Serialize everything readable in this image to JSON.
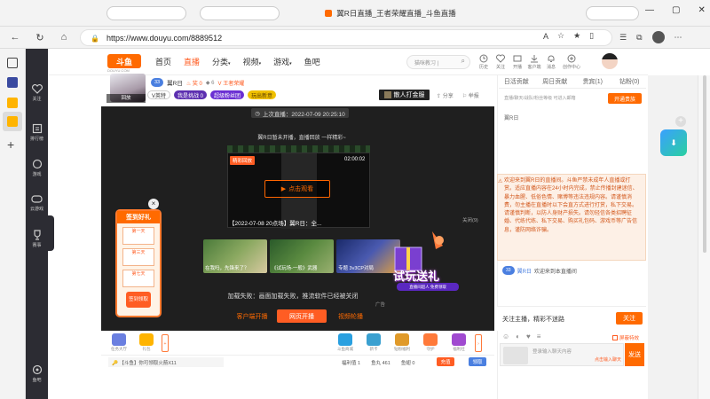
{
  "browser": {
    "window_title": "翼R日直播_王者荣耀直播_斗鱼直播",
    "url": "https://www.douyu.com/8889512",
    "reading_mode_label": "A"
  },
  "browser_sidebar": {
    "icons": [
      "tabs-icon",
      "extensions-icon",
      "douyu-tab-icon",
      "douyu-active-tab-icon",
      "add-icon"
    ]
  },
  "site_nav": {
    "items": [
      {
        "label": "关注",
        "icon": "heart-icon"
      },
      {
        "label": "排行榜",
        "icon": "rank-icon"
      },
      {
        "label": "游戏",
        "icon": "game-icon"
      },
      {
        "label": "云游戏",
        "icon": "cloud-game-icon"
      },
      {
        "label": "赛事",
        "icon": "trophy-icon"
      },
      {
        "label": "鱼吧",
        "icon": "fish-bar-icon"
      }
    ]
  },
  "header": {
    "logo": "斗鱼",
    "logo_sub": "DOUYU.COM",
    "nav": [
      {
        "label": "首页",
        "active": false
      },
      {
        "label": "直播",
        "active": true
      },
      {
        "label": "分类",
        "dropdown": true
      },
      {
        "label": "视频",
        "dropdown": true
      },
      {
        "label": "游戏",
        "dropdown": true
      },
      {
        "label": "鱼吧",
        "dropdown": false
      }
    ],
    "search_placeholder": "猫咪教习 |",
    "icons": [
      {
        "label": "历史",
        "icon": "history-icon"
      },
      {
        "label": "关注",
        "icon": "heart-icon"
      },
      {
        "label": "开播",
        "icon": "broadcast-icon"
      },
      {
        "label": "客户端",
        "icon": "download-icon"
      },
      {
        "label": "消息",
        "icon": "bell-icon"
      },
      {
        "label": "创作中心",
        "icon": "create-icon"
      }
    ]
  },
  "room": {
    "streamer_name": "翼R日",
    "level": "33",
    "fans_label": "6",
    "follow_label": "关注",
    "anchor_tag": "V英特",
    "tags": [
      "我是挑战 0",
      "超级粉丝团",
      "玩出新意"
    ],
    "fire_label": "奖 0",
    "game_label": "王者荣耀",
    "ad_button": "散人打金服",
    "share_label": "分享",
    "report_label": "举报",
    "replay_label": "回放"
  },
  "player": {
    "last_live": "上次直播：2022-07-09 20:25:10",
    "offline_msg": "翼R日暂未开播，直播回放 一样精彩~",
    "badge": "精彩回放",
    "duration": "02:00:02",
    "replay_button": "点击观看",
    "replay_caption": "【2022-07-08 20点场】翼R日：全...",
    "thumbnails": [
      {
        "title": "在我吗，先锋来了？"
      },
      {
        "title": "《试玩场-一般》武器"
      },
      {
        "title": "专题 3v3CP对局"
      }
    ],
    "close_small": "关闭(9)",
    "load_fail": "加载失败：画面加载失败，推流软件已经被关闭",
    "ad_tag": "广告",
    "buttons": {
      "client": "客户端开播",
      "web": "网页开播",
      "video": "视频轮播"
    },
    "sign_title": "签到好礼",
    "sign_days": [
      "第一天",
      "第三天",
      "第七天"
    ],
    "sign_button": "签到领取",
    "trial_text": "试玩送礼",
    "trial_sub": "直播间超人 免费领取"
  },
  "gift_bar": {
    "gifts": [
      "任务大厅",
      "礼包",
      "斗鱼商城",
      "新卡",
      "钻粉福利",
      "守护",
      "全新",
      "鱼翅",
      "福利社"
    ],
    "more": "更多"
  },
  "stat_bar": {
    "notice": "【斗鱼】你可领取火箭X11",
    "items": [
      "福利值 1",
      "鱼丸 461",
      "鱼翅 0"
    ],
    "recharge": "充值",
    "get": "领取"
  },
  "chat": {
    "tabs": [
      "日活贡献",
      "周日贡献",
      "贵宾(1)",
      "钻粉(0)"
    ],
    "tips_line": "直播/聊天/战队/粉丝等级 可进入邮箱",
    "open_button": "开通贵族",
    "top_user": "翼R日",
    "notice": "欢迎来到翼R日的直播间。斗鱼严禁未成年人直播或打赏。适应直播内容在24小时内完成，禁止传播封建迷信、暴力血腥、低俗色情、赌博等违法违规内容。请谨慎消费，勿主播在直播时以下会直方式进行打赏，私下交易。请谨慎判断，以防人身财产损失。请勿轻信各类招聘征婚、代练代练、私下交易、购买礼包码、游戏币等广告信息，谨防网络诈骗。",
    "system_msg_level": "33",
    "system_msg_user": "翼R日",
    "system_msg_text": "欢迎来到本直播间",
    "follow_text": "关注主播，精彩不迷路",
    "follow_button": "关注",
    "input_placeholder": "登录输入聊天内容",
    "input_hint": "点击输入聊天",
    "send_button": "发送",
    "block_label": "屏蔽特效"
  },
  "colors": {
    "brand": "#ff6a00",
    "live_red": "#ff5d23",
    "nav_dark": "#2c2c33",
    "notice_bg": "#fdf0e6",
    "notice_text": "#d35a1f"
  }
}
